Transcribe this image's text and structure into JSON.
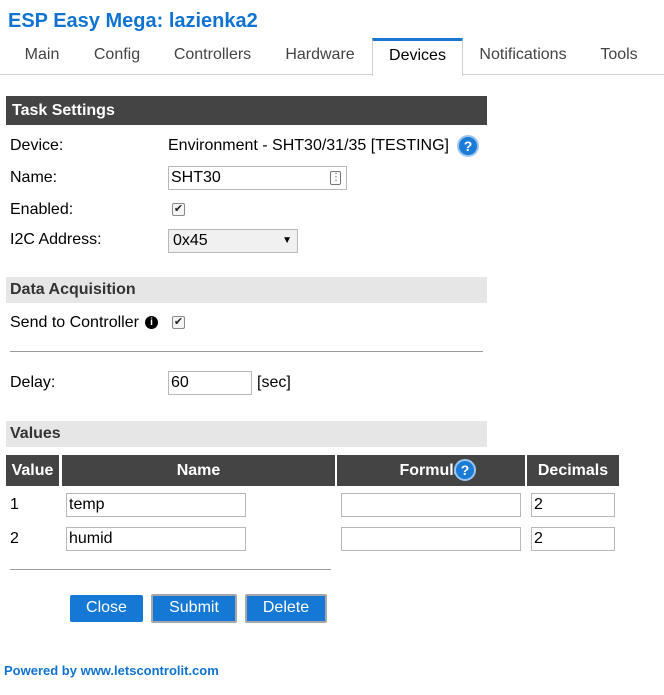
{
  "app": {
    "title": "ESP Easy Mega: lazienka2"
  },
  "tabs": [
    "Main",
    "Config",
    "Controllers",
    "Hardware",
    "Devices",
    "Notifications",
    "Tools"
  ],
  "task_settings": {
    "header": "Task Settings",
    "device_label": "Device:",
    "device_value": "Environment - SHT30/31/35 [TESTING]",
    "name_label": "Name:",
    "name_value": "SHT30",
    "enabled_label": "Enabled:",
    "i2c_label": "I2C Address:",
    "i2c_value": "0x45"
  },
  "data_acquisition": {
    "header": "Data Acquisition",
    "send_label": "Send to Controller",
    "delay_label": "Delay:",
    "delay_value": "60",
    "delay_unit": "[sec]"
  },
  "values": {
    "header": "Values",
    "columns": [
      "Value",
      "Name",
      "Formula",
      "Decimals"
    ],
    "rows": [
      {
        "index": "1",
        "name": "temp",
        "formula": "",
        "decimals": "2"
      },
      {
        "index": "2",
        "name": "humid",
        "formula": "",
        "decimals": "2"
      }
    ]
  },
  "buttons": {
    "close": "Close",
    "submit": "Submit",
    "delete": "Delete"
  },
  "icons": {
    "help": "?",
    "info": "i",
    "check": "✔",
    "dropdown": "▼",
    "password-key": "⋮"
  },
  "footer": {
    "text": "Powered by www.letscontrolit.com"
  },
  "colors": {
    "accent": "#0f73d2",
    "header_dark": "#444444",
    "button": "#1478d4"
  }
}
